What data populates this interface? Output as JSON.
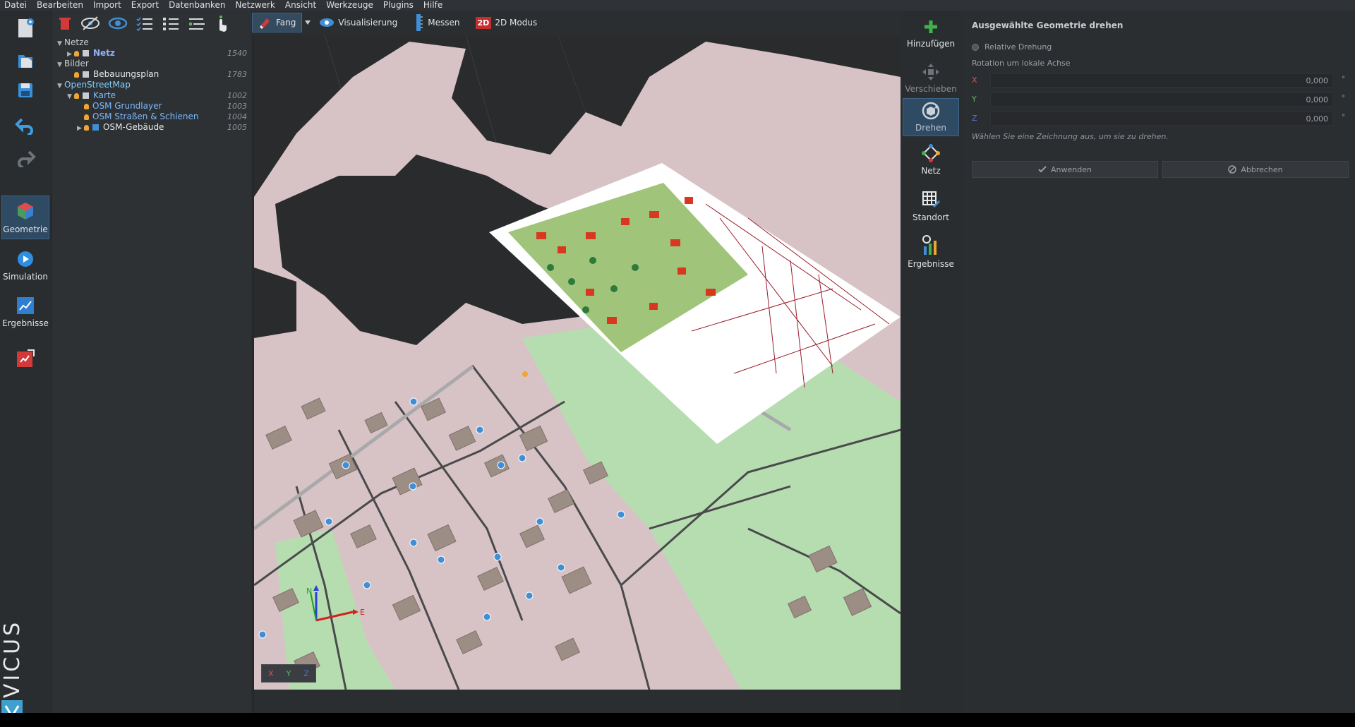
{
  "menu": [
    "Datei",
    "Bearbeiten",
    "Import",
    "Export",
    "Datenbanken",
    "Netzwerk",
    "Ansicht",
    "Werkzeuge",
    "Plugins",
    "Hilfe"
  ],
  "left_modes": [
    {
      "label": "Geometrie",
      "active": true
    },
    {
      "label": "Simulation",
      "active": false
    },
    {
      "label": "Ergebnisse",
      "active": false
    }
  ],
  "brand": "VICUS",
  "tree": [
    {
      "level": 0,
      "label": "Netze",
      "expanded": true,
      "number": ""
    },
    {
      "level": 1,
      "label": "Netz",
      "expanded": false,
      "number": "1540",
      "bold": true
    },
    {
      "level": 0,
      "label": "Bilder",
      "expanded": true,
      "number": ""
    },
    {
      "level": 1,
      "label": "Bebauungsplan",
      "number": "1783"
    },
    {
      "level": 0,
      "label": "OpenStreetMap",
      "expanded": true,
      "number": ""
    },
    {
      "level": 1,
      "label": "Karte",
      "expanded": true,
      "number": "1002"
    },
    {
      "level": 2,
      "label": "OSM Grundlayer",
      "number": "1003"
    },
    {
      "level": 2,
      "label": "OSM Straßen & Schienen",
      "number": "1004"
    },
    {
      "level": 2,
      "label": "OSM-Gebäude",
      "expanded": false,
      "number": "1005"
    }
  ],
  "viewport_toolbar": {
    "fang": "Fang",
    "visualisierung": "Visualisierung",
    "messen": "Messen",
    "modus_badge": "2D",
    "modus": "2D Modus"
  },
  "axes": {
    "x": "X",
    "y": "Y",
    "z": "Z",
    "north": "N",
    "east": "E"
  },
  "right_toolbar": [
    {
      "label": "Hinzufügen",
      "state": "normal"
    },
    {
      "label": "Verschieben",
      "state": "disabled"
    },
    {
      "label": "Drehen",
      "state": "active"
    },
    {
      "label": "Netz",
      "state": "normal"
    },
    {
      "label": "Standort",
      "state": "normal"
    },
    {
      "label": "Ergebnisse",
      "state": "normal"
    }
  ],
  "properties": {
    "title": "Ausgewählte Geometrie drehen",
    "radio_label": "Relative Drehung",
    "rotation_label": "Rotation um lokale Achse",
    "x_label": "X",
    "y_label": "Y",
    "z_label": "Z",
    "x_value": "0,000",
    "y_value": "0,000",
    "z_value": "0,000",
    "unit": "°",
    "hint": "Wählen Sie eine Zeichnung aus, um sie zu drehen.",
    "apply": "Anwenden",
    "cancel": "Abbrechen"
  },
  "colors": {
    "accent": "#3d6487",
    "x_axis": "#d9534f",
    "y_axis": "#5cb85c",
    "z_axis": "#5b6fd6",
    "map_ground": "#d7c3c6",
    "map_green": "#b6ddb0",
    "dark_area": "#2a2b2d"
  }
}
